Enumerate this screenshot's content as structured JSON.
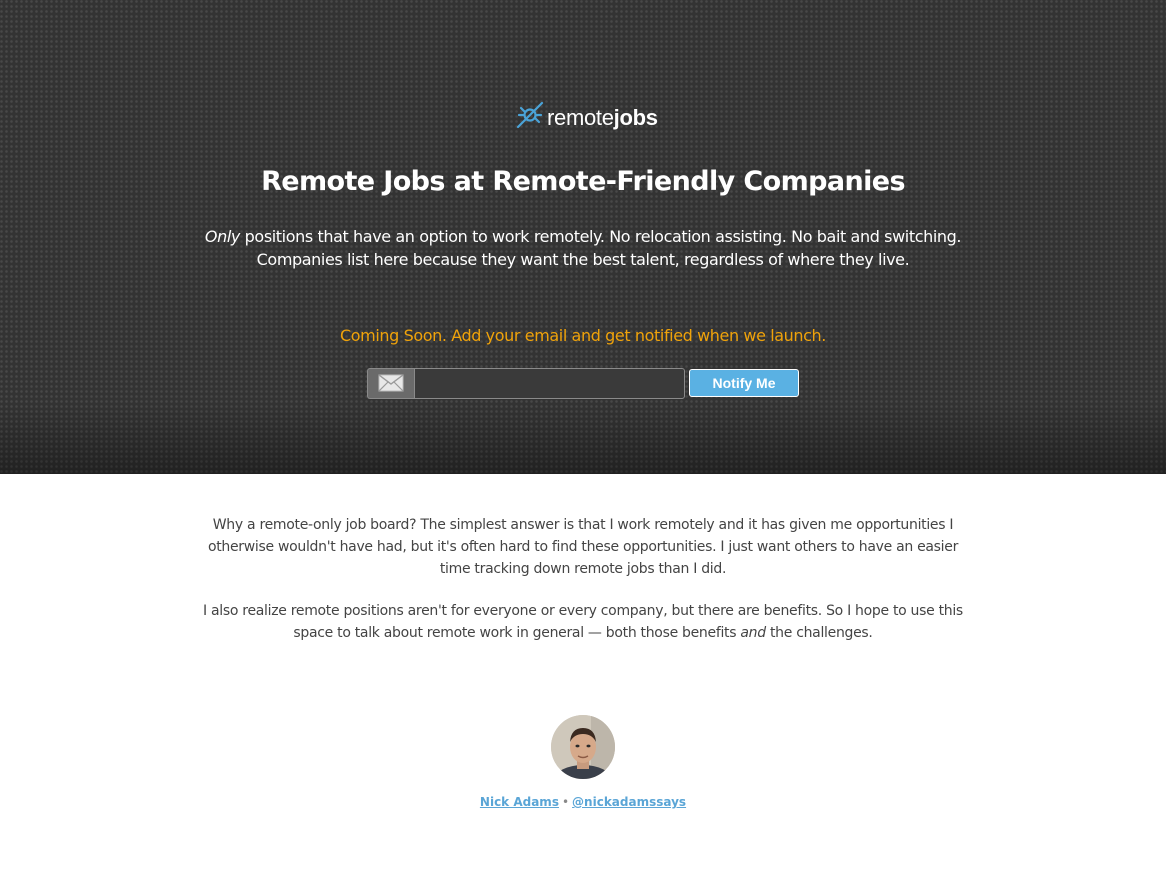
{
  "logo": {
    "word_light": "remote",
    "word_bold": "jobs",
    "icon": "satellite-icon"
  },
  "hero": {
    "title": "Remote Jobs at Remote-Friendly Companies",
    "subtitle_em": "Only",
    "subtitle_line1_rest": " positions that have an option to work remotely. No relocation assisting. No bait and switching.",
    "subtitle_line2": "Companies list here because they want the best talent, regardless of where they live.",
    "coming_soon": "Coming Soon. Add your email and get notified when we launch."
  },
  "signup": {
    "email_icon": "envelope-icon",
    "email_value": "",
    "email_placeholder": "",
    "button_label": "Notify Me"
  },
  "about": {
    "para1": "Why a remote-only job board? The simplest answer is that I work remotely and it has given me opportunities I otherwise wouldn't have had, but it's often hard to find these opportunities. I just want others to have an easier time tracking down remote jobs than I did.",
    "para2_before": "I also realize remote positions aren't for everyone or every company, but there are benefits. So I hope to use this space to talk about remote work in general — both those benefits ",
    "para2_em": "and",
    "para2_after": " the challenges."
  },
  "author": {
    "name": "Nick Adams",
    "separator": "•",
    "handle": "@nickadamssays"
  },
  "colors": {
    "hero_bg": "#333333",
    "accent_orange": "#f0a30a",
    "button_blue": "#5ab1e3",
    "link_blue": "#5aa5d6"
  }
}
